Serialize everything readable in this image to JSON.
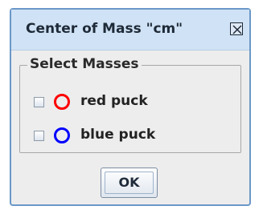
{
  "dialog": {
    "title": "Center of Mass \"cm\"",
    "close_icon": "close-icon"
  },
  "group": {
    "legend": "Select Masses"
  },
  "masses": [
    {
      "label": "red puck",
      "checked": false,
      "color": "#ff0000"
    },
    {
      "label": "blue puck",
      "checked": false,
      "color": "#0000ff"
    }
  ],
  "actions": {
    "ok_label": "OK"
  }
}
